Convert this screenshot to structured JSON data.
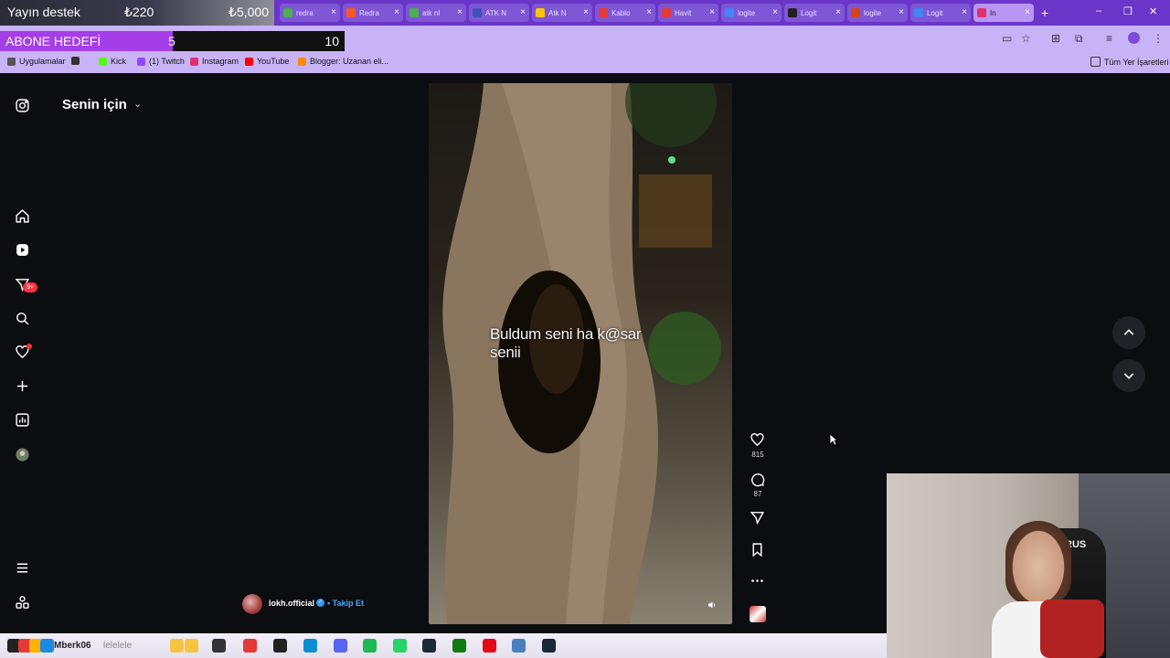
{
  "stream_overlay": {
    "donation": {
      "label": "Yayın destek",
      "current": "₺220",
      "goal": "₺5,000"
    },
    "sub_goal": {
      "label": "ABONE HEDEFİ",
      "current": "5",
      "goal": "10",
      "progress": 0.5
    }
  },
  "browser": {
    "tabs": [
      {
        "label": "redra",
        "color": "#4caf50"
      },
      {
        "label": "Redra",
        "color": "#ff5722"
      },
      {
        "label": "atk nl",
        "color": "#4caf50"
      },
      {
        "label": "ATK N",
        "color": "#3f51b5"
      },
      {
        "label": "Atk N",
        "color": "#ffc107"
      },
      {
        "label": "Kablo",
        "color": "#e53935"
      },
      {
        "label": "Havit",
        "color": "#e53935"
      },
      {
        "label": "logite",
        "color": "#4285f4"
      },
      {
        "label": "Logit",
        "color": "#222222"
      },
      {
        "label": "logite",
        "color": "#d84315"
      },
      {
        "label": "Logit",
        "color": "#4285f4"
      },
      {
        "label": "In",
        "color": "#e1306c"
      }
    ],
    "bookmarks": [
      {
        "label": "Uygulamalar",
        "icon": "apps-grid-icon",
        "color": "#555555"
      },
      {
        "label": "",
        "icon": "grid-icon",
        "color": "#333333"
      },
      {
        "label": "Kick",
        "icon": "kick-icon",
        "color": "#53fc18"
      },
      {
        "label": "(1) Twitch",
        "icon": "twitch-icon",
        "color": "#9146ff"
      },
      {
        "label": "Instagram",
        "icon": "instagram-icon",
        "color": "#e1306c"
      },
      {
        "label": "YouTube",
        "icon": "youtube-icon",
        "color": "#ff0000"
      },
      {
        "label": "Blogger: Uzanan eli...",
        "icon": "blogger-icon",
        "color": "#ff8a00"
      }
    ],
    "all_bookmarks_label": "Tüm Yer İşaretleri"
  },
  "instagram": {
    "feed_title": "Senin için",
    "messages_badge": "9+",
    "caption": "Buldum seni ha k@sar senii",
    "likes": "815",
    "comments": "87",
    "author": "lokh.official",
    "separator": "•",
    "follow_label": "Takip Et"
  },
  "webcam": {
    "chair_label": "RUS"
  },
  "taskbar": {
    "label": "Mberk06",
    "label2": "lelelele"
  }
}
